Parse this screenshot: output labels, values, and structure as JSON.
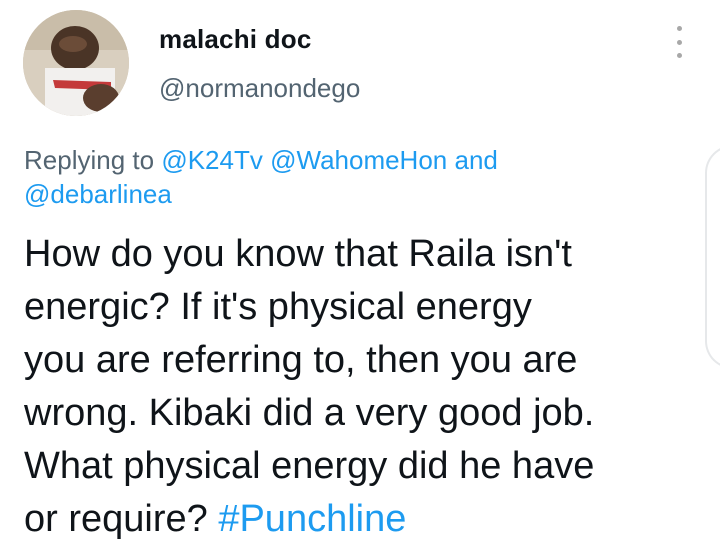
{
  "author": {
    "display_name": "malachi doc",
    "handle": "@normanondego"
  },
  "reply": {
    "prefix": "Replying to ",
    "mention_1": "@K24Tv",
    "mention_2": "@WahomeHon",
    "conjunction": " and",
    "mention_3": "@debarlinea"
  },
  "tweet": {
    "text": "How do you know that Raila isn't\nenergic? If it's physical energy\nyou are referring to, then you are\nwrong. Kibaki did a very good job.\nWhat physical energy did he have\nor require? ",
    "hashtag": "#Punchline"
  },
  "icons": {
    "more": "more-vertical-icon"
  },
  "colors": {
    "link": "#1d9bf0",
    "text": "#0f1419",
    "secondary": "#536471"
  }
}
